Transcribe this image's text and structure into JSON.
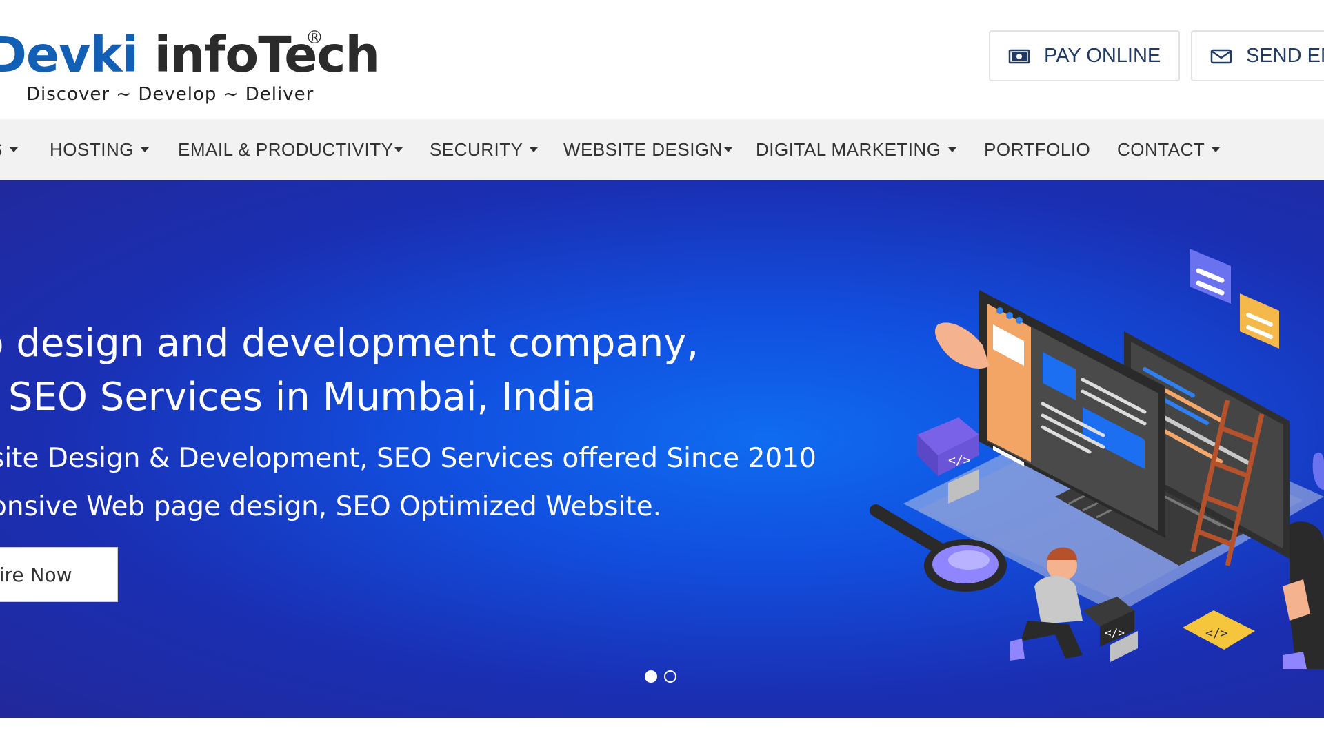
{
  "header": {
    "logo": {
      "part1": "Devki",
      "part2": "infoTech",
      "registered": "®",
      "tagline": "Discover ~ Develop ~ Deliver"
    },
    "buttons": [
      {
        "label": "PAY ONLINE",
        "icon": "money-icon"
      },
      {
        "label": "SEND EN",
        "icon": "envelope-icon"
      }
    ]
  },
  "nav": {
    "items": [
      {
        "label": "S",
        "dropdown": true
      },
      {
        "label": "HOSTING",
        "dropdown": true
      },
      {
        "label": "EMAIL & PRODUCTIVITY",
        "dropdown": true
      },
      {
        "label": "SECURITY",
        "dropdown": true
      },
      {
        "label": "WEBSITE DESIGN",
        "dropdown": true
      },
      {
        "label": "DIGITAL MARKETING",
        "dropdown": true
      },
      {
        "label": "PORTFOLIO",
        "dropdown": false
      },
      {
        "label": "CONTACT",
        "dropdown": true
      }
    ]
  },
  "hero": {
    "headline_line1": "b design and development company,",
    "headline_line2": "SEO Services in Mumbai, India",
    "sub_line1": "site Design & Development, SEO Services offered Since 2010",
    "sub_line2": "onsive Web page design, SEO Optimized Website.",
    "cta_label": "uire Now",
    "slides_total": 2,
    "slide_active": 1
  },
  "colors": {
    "logo_blue": "#1160b6",
    "logo_dark": "#2b2b2b",
    "nav_bg": "#f2f2f2",
    "hero_blue": "#1150e0",
    "button_text": "#1f3b66"
  }
}
